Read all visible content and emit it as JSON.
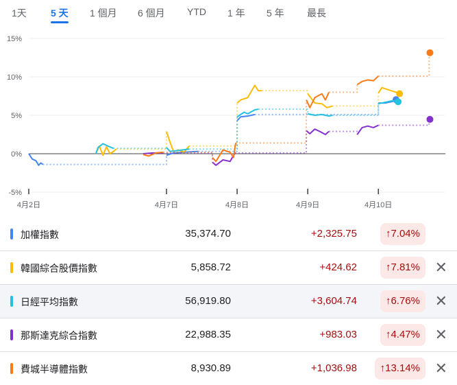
{
  "tabs": [
    "1天",
    "5 天",
    "1 個月",
    "6 個月",
    "YTD",
    "1 年",
    "5 年",
    "最長"
  ],
  "active_tab": 1,
  "chart_data": {
    "type": "line",
    "xlabel": "",
    "ylabel": "",
    "ylim": [
      -5,
      15
    ],
    "xlim": [
      0,
      5.85
    ],
    "yticks": [
      15,
      10,
      5,
      0,
      -5
    ],
    "ytick_labels": [
      "15%",
      "10%",
      "5%",
      "0%",
      "-5%"
    ],
    "xticks": [
      0,
      1.95,
      2.95,
      3.95,
      4.95
    ],
    "xtick_labels": [
      "4月2日",
      "4月7日",
      "4月8日",
      "4月9日",
      "4月10日"
    ],
    "series": [
      {
        "name": "加權指數",
        "color": "#4285f4",
        "segments": [
          [
            [
              0,
              0
            ],
            [
              0.05,
              -0.7
            ],
            [
              0.1,
              -0.9
            ],
            [
              0.14,
              -1.5
            ],
            [
              0.17,
              -1.2
            ],
            [
              0.2,
              -1.4
            ]
          ],
          [
            [
              1.95,
              -0.2
            ],
            [
              2.05,
              0.1
            ],
            [
              2.2,
              0.2
            ],
            [
              2.4,
              0.3
            ]
          ],
          [
            [
              2.95,
              4.3
            ],
            [
              3.0,
              4.8
            ],
            [
              3.1,
              4.9
            ],
            [
              3.2,
              5.1
            ]
          ],
          [
            [
              4.95,
              6.6
            ],
            [
              5.05,
              6.6
            ],
            [
              5.15,
              6.8
            ],
            [
              5.2,
              7.04
            ]
          ]
        ]
      },
      {
        "name": "韓國綜合股價指數",
        "color": "#fbbc04",
        "segments": [
          [
            [
              0.95,
              0
            ],
            [
              1.0,
              1.0
            ],
            [
              1.05,
              -0.2
            ],
            [
              1.1,
              0.9
            ],
            [
              1.15,
              0
            ],
            [
              1.2,
              0.3
            ],
            [
              1.24,
              0.6
            ]
          ],
          [
            [
              1.95,
              2.9
            ],
            [
              2.0,
              1.5
            ],
            [
              2.05,
              0.3
            ],
            [
              2.12,
              0.5
            ],
            [
              2.2,
              0.2
            ],
            [
              2.27,
              1.0
            ]
          ],
          [
            [
              2.95,
              6.6
            ],
            [
              3.0,
              7.0
            ],
            [
              3.1,
              7.3
            ],
            [
              3.2,
              8.9
            ],
            [
              3.25,
              8.2
            ],
            [
              3.3,
              8.2
            ]
          ],
          [
            [
              3.95,
              7.8
            ],
            [
              4.05,
              6.6
            ],
            [
              4.15,
              6.5
            ],
            [
              4.22,
              6.0
            ],
            [
              4.3,
              6.2
            ]
          ],
          [
            [
              4.95,
              7.9
            ],
            [
              5.0,
              8.6
            ],
            [
              5.1,
              8.3
            ],
            [
              5.2,
              8.0
            ],
            [
              5.25,
              7.81
            ]
          ]
        ]
      },
      {
        "name": "日經平均指數",
        "color": "#24c1e0",
        "segments": [
          [
            [
              0.95,
              0
            ],
            [
              0.98,
              0.8
            ],
            [
              1.05,
              1.3
            ],
            [
              1.12,
              1.0
            ],
            [
              1.2,
              0.7
            ]
          ],
          [
            [
              1.95,
              0.8
            ],
            [
              2.0,
              0.3
            ],
            [
              2.1,
              0.4
            ],
            [
              2.27,
              0.6
            ]
          ],
          [
            [
              2.95,
              4.8
            ],
            [
              3.05,
              5.4
            ],
            [
              3.1,
              5.2
            ],
            [
              3.2,
              5.7
            ],
            [
              3.25,
              5.8
            ]
          ],
          [
            [
              3.95,
              5.2
            ],
            [
              4.05,
              5.0
            ],
            [
              4.15,
              5.1
            ],
            [
              4.25,
              4.9
            ],
            [
              4.3,
              5.0
            ]
          ],
          [
            [
              4.95,
              6.5
            ],
            [
              5.05,
              6.7
            ],
            [
              5.15,
              6.9
            ],
            [
              5.23,
              6.76
            ]
          ]
        ]
      },
      {
        "name": "那斯達克綜合指數",
        "color": "#8430ce",
        "segments": [
          [
            [
              1.62,
              0
            ],
            [
              1.75,
              0.1
            ],
            [
              1.9,
              0.1
            ]
          ],
          [
            [
              2.6,
              -1.1
            ],
            [
              2.65,
              -1.5
            ],
            [
              2.75,
              -0.8
            ],
            [
              2.85,
              -1.0
            ],
            [
              2.92,
              0.1
            ]
          ],
          [
            [
              3.93,
              3.0
            ],
            [
              3.98,
              2.6
            ],
            [
              4.05,
              3.2
            ],
            [
              4.12,
              2.9
            ],
            [
              4.2,
              2.5
            ],
            [
              4.25,
              2.9
            ]
          ],
          [
            [
              4.65,
              2.5
            ],
            [
              4.72,
              3.4
            ],
            [
              4.8,
              3.6
            ],
            [
              4.88,
              3.4
            ],
            [
              4.95,
              3.7
            ]
          ],
          [
            [
              5.67,
              4.3
            ],
            [
              5.68,
              4.47
            ]
          ]
        ]
      },
      {
        "name": "費城半導體指數",
        "color": "#fa7b17",
        "segments": [
          [
            [
              1.62,
              -0.1
            ],
            [
              1.7,
              -0.3
            ],
            [
              1.8,
              0.1
            ],
            [
              1.9,
              0.2
            ]
          ],
          [
            [
              2.6,
              -0.5
            ],
            [
              2.65,
              -1.0
            ],
            [
              2.75,
              0.5
            ],
            [
              2.85,
              0.2
            ],
            [
              2.9,
              -0.5
            ],
            [
              2.93,
              1.4
            ]
          ],
          [
            [
              3.93,
              7.0
            ],
            [
              3.98,
              6.0
            ],
            [
              4.05,
              7.3
            ],
            [
              4.15,
              7.8
            ],
            [
              4.2,
              7.0
            ],
            [
              4.25,
              8.0
            ]
          ],
          [
            [
              4.65,
              9.0
            ],
            [
              4.72,
              9.4
            ],
            [
              4.8,
              9.6
            ],
            [
              4.88,
              9.5
            ],
            [
              4.95,
              10.1
            ]
          ],
          [
            [
              5.67,
              12.9
            ],
            [
              5.68,
              13.14
            ]
          ]
        ]
      }
    ]
  },
  "rows": [
    {
      "name": "加權指數",
      "price": "35,374.70",
      "change": "+2,325.75",
      "pct": "↑7.04%",
      "color": "#4285f4",
      "removable": false
    },
    {
      "name": "韓國綜合股價指數",
      "price": "5,858.72",
      "change": "+424.62",
      "pct": "↑7.81%",
      "color": "#fbbc04",
      "removable": true
    },
    {
      "name": "日經平均指數",
      "price": "56,919.80",
      "change": "+3,604.74",
      "pct": "↑6.76%",
      "color": "#24c1e0",
      "removable": true
    },
    {
      "name": "那斯達克綜合指數",
      "price": "22,988.35",
      "change": "+983.03",
      "pct": "↑4.47%",
      "color": "#8430ce",
      "removable": true
    },
    {
      "name": "費城半導體指數",
      "price": "8,930.89",
      "change": "+1,036.98",
      "pct": "↑13.14%",
      "color": "#fa7b17",
      "removable": true
    }
  ],
  "remove_glyph": "✕"
}
